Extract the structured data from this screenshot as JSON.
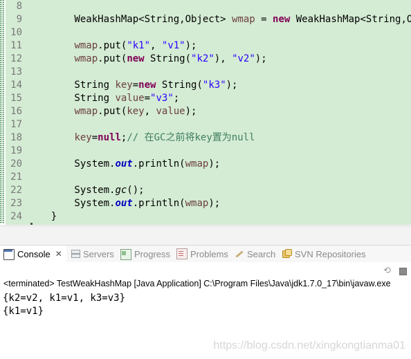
{
  "editor": {
    "lines": [
      {
        "n": "8",
        "tokens": []
      },
      {
        "n": "9",
        "tokens": [
          {
            "t": "        WeakHashMap<String,Object> ",
            "c": ""
          },
          {
            "t": "wmap",
            "c": "var"
          },
          {
            "t": " = ",
            "c": ""
          },
          {
            "t": "new",
            "c": "kw"
          },
          {
            "t": " WeakHashMap<String,Object>();",
            "c": ""
          }
        ]
      },
      {
        "n": "10",
        "tokens": []
      },
      {
        "n": "11",
        "tokens": [
          {
            "t": "        ",
            "c": ""
          },
          {
            "t": "wmap",
            "c": "var"
          },
          {
            "t": ".put(",
            "c": ""
          },
          {
            "t": "\"k1\"",
            "c": "str"
          },
          {
            "t": ", ",
            "c": ""
          },
          {
            "t": "\"v1\"",
            "c": "str"
          },
          {
            "t": ");",
            "c": ""
          }
        ]
      },
      {
        "n": "12",
        "tokens": [
          {
            "t": "        ",
            "c": ""
          },
          {
            "t": "wmap",
            "c": "var"
          },
          {
            "t": ".put(",
            "c": ""
          },
          {
            "t": "new",
            "c": "kw"
          },
          {
            "t": " String(",
            "c": ""
          },
          {
            "t": "\"k2\"",
            "c": "str"
          },
          {
            "t": "), ",
            "c": ""
          },
          {
            "t": "\"v2\"",
            "c": "str"
          },
          {
            "t": ");",
            "c": ""
          }
        ]
      },
      {
        "n": "13",
        "tokens": []
      },
      {
        "n": "14",
        "tokens": [
          {
            "t": "        String ",
            "c": ""
          },
          {
            "t": "key",
            "c": "var"
          },
          {
            "t": "=",
            "c": ""
          },
          {
            "t": "new",
            "c": "kw"
          },
          {
            "t": " String(",
            "c": ""
          },
          {
            "t": "\"k3\"",
            "c": "str"
          },
          {
            "t": ");",
            "c": ""
          }
        ]
      },
      {
        "n": "15",
        "tokens": [
          {
            "t": "        String ",
            "c": ""
          },
          {
            "t": "value",
            "c": "var"
          },
          {
            "t": "=",
            "c": ""
          },
          {
            "t": "\"v3\"",
            "c": "str"
          },
          {
            "t": ";",
            "c": ""
          }
        ]
      },
      {
        "n": "16",
        "tokens": [
          {
            "t": "        ",
            "c": ""
          },
          {
            "t": "wmap",
            "c": "var"
          },
          {
            "t": ".put(",
            "c": ""
          },
          {
            "t": "key",
            "c": "var"
          },
          {
            "t": ", ",
            "c": ""
          },
          {
            "t": "value",
            "c": "var"
          },
          {
            "t": ");",
            "c": ""
          }
        ]
      },
      {
        "n": "17",
        "tokens": []
      },
      {
        "n": "18",
        "tokens": [
          {
            "t": "        ",
            "c": ""
          },
          {
            "t": "key",
            "c": "var"
          },
          {
            "t": "=",
            "c": ""
          },
          {
            "t": "null",
            "c": "kw"
          },
          {
            "t": ";",
            "c": ""
          },
          {
            "t": "// 在GC之前将key置为null",
            "c": "cmt"
          }
        ]
      },
      {
        "n": "19",
        "tokens": []
      },
      {
        "n": "20",
        "tokens": [
          {
            "t": "        System.",
            "c": ""
          },
          {
            "t": "out",
            "c": "fld"
          },
          {
            "t": ".println(",
            "c": ""
          },
          {
            "t": "wmap",
            "c": "var"
          },
          {
            "t": ");",
            "c": ""
          }
        ]
      },
      {
        "n": "21",
        "tokens": []
      },
      {
        "n": "22",
        "tokens": [
          {
            "t": "        System.",
            "c": ""
          },
          {
            "t": "gc",
            "c": "stm"
          },
          {
            "t": "();",
            "c": ""
          }
        ]
      },
      {
        "n": "23",
        "tokens": [
          {
            "t": "        System.",
            "c": ""
          },
          {
            "t": "out",
            "c": "fld"
          },
          {
            "t": ".println(",
            "c": ""
          },
          {
            "t": "wmap",
            "c": "var"
          },
          {
            "t": ");",
            "c": ""
          }
        ]
      },
      {
        "n": "24",
        "tokens": [
          {
            "t": "    }",
            "c": ""
          }
        ]
      }
    ]
  },
  "tabs": [
    {
      "label": "Console",
      "icon": "console-icon",
      "active": true,
      "closable": true
    },
    {
      "label": "Servers",
      "icon": "servers-icon",
      "active": false
    },
    {
      "label": "Progress",
      "icon": "progress-icon",
      "active": false
    },
    {
      "label": "Problems",
      "icon": "problems-icon",
      "active": false
    },
    {
      "label": "Search",
      "icon": "search-icon",
      "active": false
    },
    {
      "label": "SVN Repositories",
      "icon": "svn-repositories-icon",
      "active": false
    }
  ],
  "console": {
    "status": "<terminated> TestWeakHashMap [Java Application] C:\\Program Files\\Java\\jdk1.7.0_17\\bin\\javaw.exe",
    "output": [
      "{k2=v2, k1=v1, k3=v3}",
      "{k1=v1}"
    ]
  },
  "watermark": "https://blog.csdn.net/xingkongtianma01",
  "colors": {
    "editor_bg": "#d4ebd4",
    "keyword": "#7f0055",
    "string": "#2a00ff",
    "variable": "#6a3e3e",
    "field": "#0000c0",
    "comment": "#3f7f5f"
  }
}
